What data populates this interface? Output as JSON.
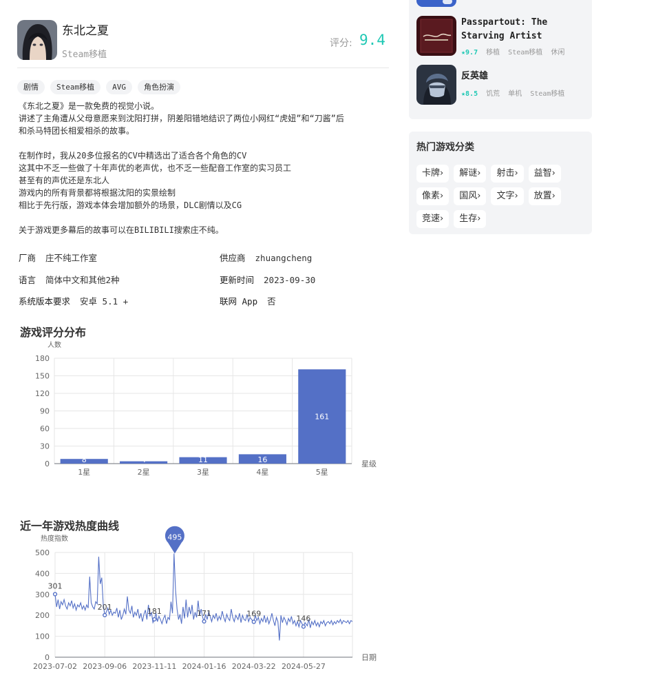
{
  "game": {
    "title": "东北之夏",
    "subtitle": "Steam移植",
    "rating_label": "评分:",
    "rating_value": "9.4",
    "tags": [
      "剧情",
      "Steam移植",
      "AVG",
      "角色扮演"
    ],
    "description": [
      "《东北之夏》是一款免费的视觉小说。",
      "讲述了主角遭从父母意愿来到沈阳打拼，阴差阳错地结识了两位小网红“虎妞”和“刀酱”后",
      "和杀马特团长相爱相杀的故事。",
      "",
      "在制作时，我从20多位报名的CV中精选出了适合各个角色的CV",
      "这其中不乏一些做了十年声优的老声优，也不乏一些配音工作室的实习员工",
      "甚至有的声优还是东北人",
      "游戏内的所有背景都将根据沈阳的实景绘制",
      "相比于先行版，游戏本体会增加额外的场景，DLC剧情以及CG",
      "",
      "关于游戏更多幕后的故事可以在BILIBILI搜索庄不纯。"
    ],
    "info": {
      "vendor_label": "厂商",
      "vendor": "庄不纯工作室",
      "supplier_label": "供应商",
      "supplier": "zhuangcheng",
      "language_label": "语言",
      "language": "简体中文和其他2种",
      "updated_label": "更新时间",
      "updated": "2023-09-30",
      "system_label": "系统版本要求",
      "system": "安卓 5.1 +",
      "online_label": "联网 App",
      "online": "否"
    }
  },
  "rating_section_title": "游戏评分分布",
  "heat_section_title": "近一年游戏热度曲线",
  "chart_data": [
    {
      "type": "bar",
      "ylabel": "人数",
      "xlabel": "星级",
      "categories": [
        "1星",
        "2星",
        "3星",
        "4星",
        "5星"
      ],
      "values": [
        8,
        4,
        11,
        16,
        161
      ],
      "ylim": [
        0,
        180
      ],
      "yticks": [
        0,
        30,
        60,
        90,
        120,
        150,
        180
      ],
      "grid": true,
      "color": "#5470c6"
    },
    {
      "type": "line",
      "ylabel": "热度指数",
      "xlabel": "日期",
      "ylim": [
        0,
        500
      ],
      "yticks": [
        0,
        100,
        200,
        300,
        400,
        500
      ],
      "x_ticks": [
        "2023-07-02",
        "2023-09-06",
        "2023-11-11",
        "2024-01-16",
        "2024-03-22",
        "2024-05-27"
      ],
      "x_range": [
        "2023-07-02",
        "2024-07-31"
      ],
      "labeled_points": [
        {
          "x": "2023-07-02",
          "y": 301
        },
        {
          "x": "2023-09-06",
          "y": 201
        },
        {
          "x": "2023-11-11",
          "y": 181
        },
        {
          "x": "2024-01-16",
          "y": 171
        },
        {
          "x": "2024-03-22",
          "y": 169
        },
        {
          "x": "2024-05-27",
          "y": 146
        }
      ],
      "max_point": {
        "x": "2023-12-08",
        "y": 495
      },
      "series": [
        {
          "points": [
            [
              "2023-07-02",
              301
            ],
            [
              "2023-07-04",
              240
            ],
            [
              "2023-07-06",
              275
            ],
            [
              "2023-07-08",
              230
            ],
            [
              "2023-07-10",
              265
            ],
            [
              "2023-07-12",
              250
            ],
            [
              "2023-07-14",
              275
            ],
            [
              "2023-07-16",
              245
            ],
            [
              "2023-07-18",
              230
            ],
            [
              "2023-07-20",
              260
            ],
            [
              "2023-07-22",
              245
            ],
            [
              "2023-07-24",
              270
            ],
            [
              "2023-07-26",
              235
            ],
            [
              "2023-07-28",
              255
            ],
            [
              "2023-07-30",
              225
            ],
            [
              "2023-08-01",
              250
            ],
            [
              "2023-08-03",
              240
            ],
            [
              "2023-08-05",
              260
            ],
            [
              "2023-08-07",
              230
            ],
            [
              "2023-08-09",
              245
            ],
            [
              "2023-08-11",
              225
            ],
            [
              "2023-08-13",
              250
            ],
            [
              "2023-08-15",
              235
            ],
            [
              "2023-08-17",
              385
            ],
            [
              "2023-08-19",
              260
            ],
            [
              "2023-08-21",
              240
            ],
            [
              "2023-08-23",
              230
            ],
            [
              "2023-08-25",
              265
            ],
            [
              "2023-08-27",
              255
            ],
            [
              "2023-08-29",
              480
            ],
            [
              "2023-08-31",
              350
            ],
            [
              "2023-09-02",
              380
            ],
            [
              "2023-09-04",
              250
            ],
            [
              "2023-09-06",
              201
            ],
            [
              "2023-09-08",
              215
            ],
            [
              "2023-09-10",
              235
            ],
            [
              "2023-09-12",
              205
            ],
            [
              "2023-09-14",
              225
            ],
            [
              "2023-09-16",
              200
            ],
            [
              "2023-09-18",
              215
            ],
            [
              "2023-09-20",
              210
            ],
            [
              "2023-09-22",
              235
            ],
            [
              "2023-09-24",
              190
            ],
            [
              "2023-09-26",
              225
            ],
            [
              "2023-09-28",
              180
            ],
            [
              "2023-09-30",
              200
            ],
            [
              "2023-10-02",
              230
            ],
            [
              "2023-10-04",
              205
            ],
            [
              "2023-10-06",
              290
            ],
            [
              "2023-10-08",
              225
            ],
            [
              "2023-10-10",
              210
            ],
            [
              "2023-10-12",
              245
            ],
            [
              "2023-10-14",
              190
            ],
            [
              "2023-10-16",
              215
            ],
            [
              "2023-10-18",
              200
            ],
            [
              "2023-10-20",
              230
            ],
            [
              "2023-10-22",
              185
            ],
            [
              "2023-10-24",
              210
            ],
            [
              "2023-10-26",
              170
            ],
            [
              "2023-10-28",
              205
            ],
            [
              "2023-10-30",
              225
            ],
            [
              "2023-11-01",
              180
            ],
            [
              "2023-11-03",
              250
            ],
            [
              "2023-11-05",
              195
            ],
            [
              "2023-11-07",
              215
            ],
            [
              "2023-11-09",
              165
            ],
            [
              "2023-11-11",
              181
            ],
            [
              "2023-11-13",
              210
            ],
            [
              "2023-11-15",
              170
            ],
            [
              "2023-11-17",
              195
            ],
            [
              "2023-11-19",
              180
            ],
            [
              "2023-11-21",
              160
            ],
            [
              "2023-11-23",
              185
            ],
            [
              "2023-11-25",
              200
            ],
            [
              "2023-11-27",
              160
            ],
            [
              "2023-11-29",
              190
            ],
            [
              "2023-12-01",
              180
            ],
            [
              "2023-12-03",
              265
            ],
            [
              "2023-12-05",
              210
            ],
            [
              "2023-12-07",
              495
            ],
            [
              "2023-12-09",
              320
            ],
            [
              "2023-12-11",
              230
            ],
            [
              "2023-12-13",
              180
            ],
            [
              "2023-12-15",
              205
            ],
            [
              "2023-12-17",
              160
            ],
            [
              "2023-12-19",
              240
            ],
            [
              "2023-12-21",
              185
            ],
            [
              "2023-12-23",
              275
            ],
            [
              "2023-12-25",
              190
            ],
            [
              "2023-12-27",
              240
            ],
            [
              "2023-12-29",
              205
            ],
            [
              "2023-12-31",
              250
            ],
            [
              "2024-01-02",
              180
            ],
            [
              "2024-01-04",
              215
            ],
            [
              "2024-01-06",
              190
            ],
            [
              "2024-01-08",
              270
            ],
            [
              "2024-01-10",
              200
            ],
            [
              "2024-01-12",
              230
            ],
            [
              "2024-01-14",
              190
            ],
            [
              "2024-01-16",
              171
            ],
            [
              "2024-01-18",
              205
            ],
            [
              "2024-01-20",
              180
            ],
            [
              "2024-01-22",
              215
            ],
            [
              "2024-01-24",
              195
            ],
            [
              "2024-01-26",
              170
            ],
            [
              "2024-01-28",
              200
            ],
            [
              "2024-01-30",
              185
            ],
            [
              "2024-02-01",
              210
            ],
            [
              "2024-02-03",
              175
            ],
            [
              "2024-02-05",
              195
            ],
            [
              "2024-02-07",
              180
            ],
            [
              "2024-02-09",
              220
            ],
            [
              "2024-02-11",
              190
            ],
            [
              "2024-02-13",
              170
            ],
            [
              "2024-02-15",
              205
            ],
            [
              "2024-02-17",
              185
            ],
            [
              "2024-02-19",
              175
            ],
            [
              "2024-02-21",
              230
            ],
            [
              "2024-02-23",
              190
            ],
            [
              "2024-02-25",
              170
            ],
            [
              "2024-02-27",
              200
            ],
            [
              "2024-03-01",
              180
            ],
            [
              "2024-03-03",
              210
            ],
            [
              "2024-03-05",
              165
            ],
            [
              "2024-03-07",
              200
            ],
            [
              "2024-03-09",
              180
            ],
            [
              "2024-03-11",
              175
            ],
            [
              "2024-03-13",
              205
            ],
            [
              "2024-03-15",
              170
            ],
            [
              "2024-03-17",
              190
            ],
            [
              "2024-03-19",
              180
            ],
            [
              "2024-03-22",
              169
            ],
            [
              "2024-03-24",
              200
            ],
            [
              "2024-03-26",
              175
            ],
            [
              "2024-03-28",
              190
            ],
            [
              "2024-03-30",
              160
            ],
            [
              "2024-04-01",
              185
            ],
            [
              "2024-04-03",
              170
            ],
            [
              "2024-04-05",
              200
            ],
            [
              "2024-04-07",
              165
            ],
            [
              "2024-04-09",
              190
            ],
            [
              "2024-04-11",
              160
            ],
            [
              "2024-04-13",
              180
            ],
            [
              "2024-04-15",
              210
            ],
            [
              "2024-04-17",
              175
            ],
            [
              "2024-04-19",
              150
            ],
            [
              "2024-04-21",
              190
            ],
            [
              "2024-04-23",
              170
            ],
            [
              "2024-04-25",
              80
            ],
            [
              "2024-04-27",
              200
            ],
            [
              "2024-04-29",
              165
            ],
            [
              "2024-05-01",
              190
            ],
            [
              "2024-05-03",
              175
            ],
            [
              "2024-05-05",
              155
            ],
            [
              "2024-05-07",
              185
            ],
            [
              "2024-05-09",
              170
            ],
            [
              "2024-05-11",
              195
            ],
            [
              "2024-05-13",
              160
            ],
            [
              "2024-05-15",
              175
            ],
            [
              "2024-05-17",
              150
            ],
            [
              "2024-05-19",
              170
            ],
            [
              "2024-05-21",
              145
            ],
            [
              "2024-05-23",
              175
            ],
            [
              "2024-05-25",
              160
            ],
            [
              "2024-05-27",
              146
            ],
            [
              "2024-05-29",
              165
            ],
            [
              "2024-06-01",
              150
            ],
            [
              "2024-06-03",
              180
            ],
            [
              "2024-06-05",
              140
            ],
            [
              "2024-06-07",
              170
            ],
            [
              "2024-06-09",
              155
            ],
            [
              "2024-06-11",
              175
            ],
            [
              "2024-06-13",
              150
            ],
            [
              "2024-06-15",
              165
            ],
            [
              "2024-06-17",
              145
            ],
            [
              "2024-06-19",
              170
            ],
            [
              "2024-06-21",
              160
            ],
            [
              "2024-06-23",
              175
            ],
            [
              "2024-06-25",
              150
            ],
            [
              "2024-06-27",
              165
            ],
            [
              "2024-06-29",
              170
            ],
            [
              "2024-07-01",
              160
            ],
            [
              "2024-07-03",
              175
            ],
            [
              "2024-07-05",
              155
            ],
            [
              "2024-07-07",
              170
            ],
            [
              "2024-07-09",
              160
            ],
            [
              "2024-07-11",
              175
            ],
            [
              "2024-07-13",
              165
            ],
            [
              "2024-07-15",
              180
            ],
            [
              "2024-07-17",
              160
            ],
            [
              "2024-07-19",
              175
            ],
            [
              "2024-07-21",
              170
            ],
            [
              "2024-07-23",
              165
            ],
            [
              "2024-07-25",
              175
            ],
            [
              "2024-07-27",
              160
            ],
            [
              "2024-07-29",
              175
            ],
            [
              "2024-07-31",
              170
            ]
          ]
        }
      ],
      "color": "#5470c6"
    }
  ],
  "related_games": [
    {
      "name_lines": [
        "Passpartout: The",
        "Starving Artist"
      ],
      "score": "9.7",
      "tags": [
        "移植",
        "Steam移植",
        "休闲"
      ],
      "icon": "passpartout-icon"
    },
    {
      "name_lines": [
        "反英雄"
      ],
      "score": "8.5",
      "tags": [
        "饥荒",
        "单机",
        "Steam移植"
      ],
      "icon": "antihero-icon"
    }
  ],
  "categories": {
    "title": "热门游戏分类",
    "items": [
      "卡牌",
      "解谜",
      "射击",
      "益智",
      "像素",
      "国风",
      "文字",
      "放置",
      "竞速",
      "生存"
    ],
    "chevron": "›"
  }
}
